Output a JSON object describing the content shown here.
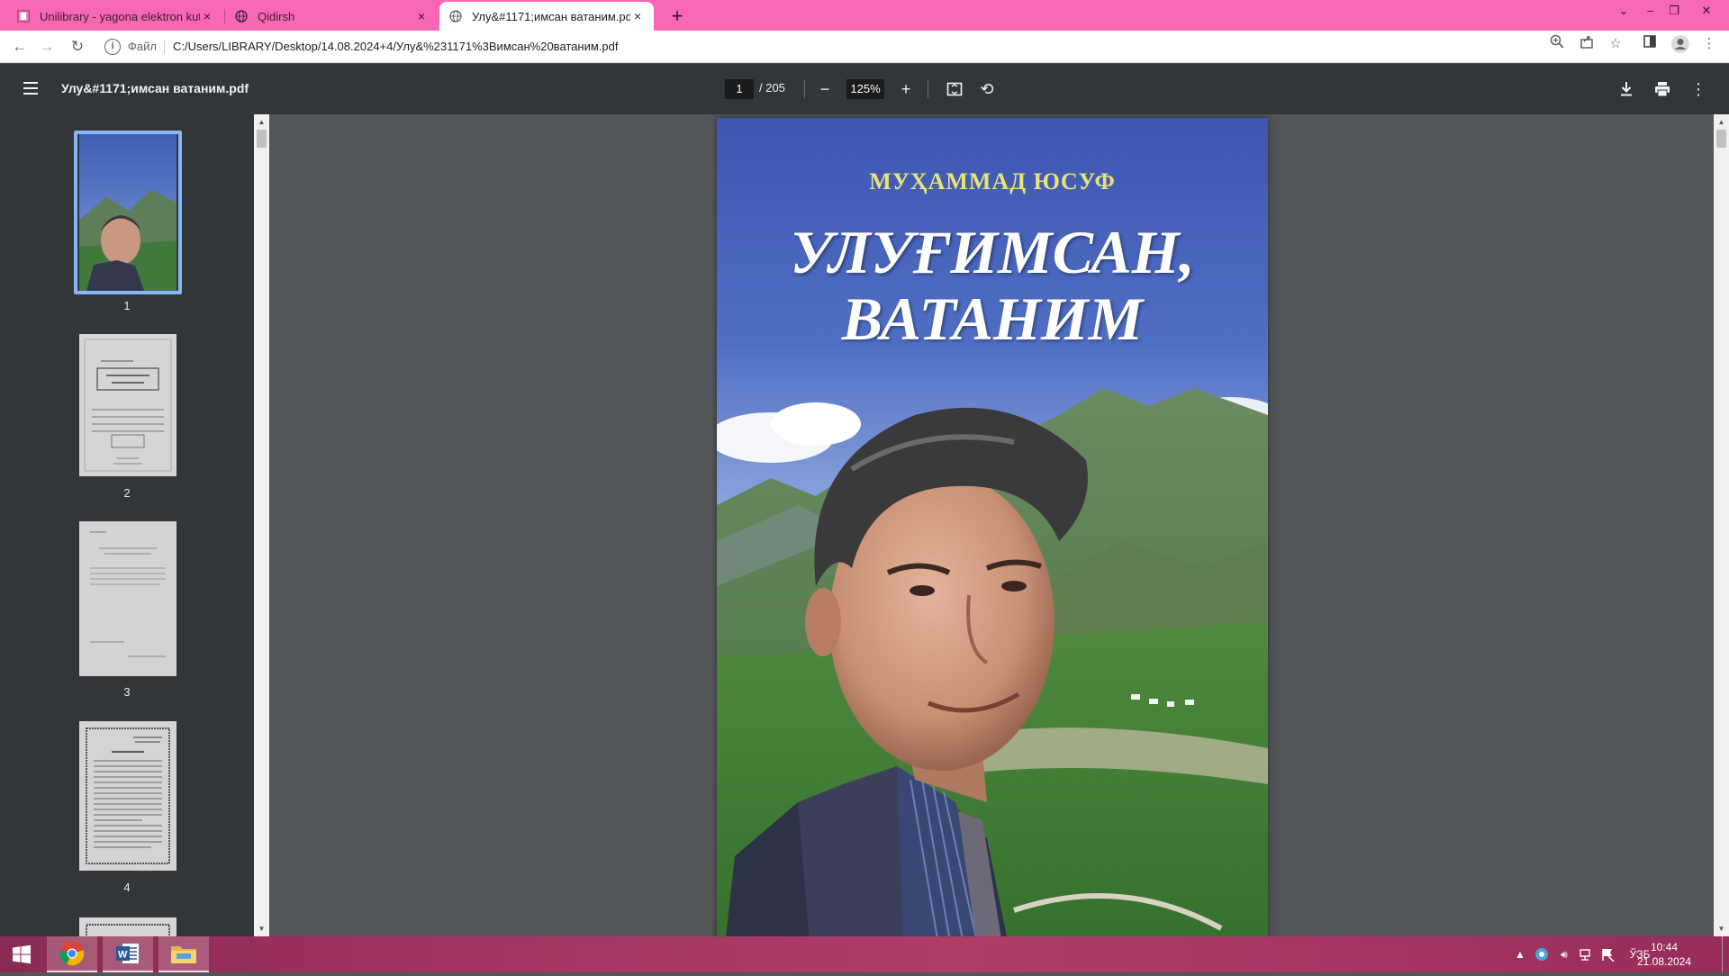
{
  "tabs": [
    {
      "title": "Unilibrary - yagona elektron kutubx",
      "close": "×"
    },
    {
      "title": "Qidirsh",
      "close": "×"
    },
    {
      "title": "Улу&#1171;имсан ватаним.pdf",
      "close": "×"
    }
  ],
  "new_tab": "+",
  "address": {
    "scheme_label": "Файл",
    "url": "C:/Users/LIBRARY/Desktop/14.08.2024+4/Улу&%231171%3Вимсан%20ватаним.pdf"
  },
  "pdf": {
    "title": "Улу&#1171;имсан ватаним.pdf",
    "current_page": "1",
    "total_pages": "/ 205",
    "zoom": "125%"
  },
  "cover": {
    "author": "МУҲАММАД ЮСУФ",
    "title_line1": "УЛУҒИМСАН,",
    "title_line2": "ВАТАНИМ"
  },
  "thumbnails": [
    {
      "number": "1",
      "selected": true
    },
    {
      "number": "2",
      "selected": false
    },
    {
      "number": "3",
      "selected": false
    },
    {
      "number": "4",
      "selected": false
    }
  ],
  "thumb2_text": {
    "author": "Муҳаммад Юсуф",
    "title": "УЛУҒИМСАН, ВАТАНИМ"
  },
  "taskbar": {
    "language": "ЎЗБ",
    "time": "10:44",
    "date": "21.08.2024"
  },
  "colors": {
    "tabbar": "#f767b4",
    "pdf_toolbar": "#323639",
    "viewer_bg": "#525659",
    "selection": "#8ab4f8",
    "cover_title": "#ffffff",
    "cover_author": "#e8e27a"
  }
}
